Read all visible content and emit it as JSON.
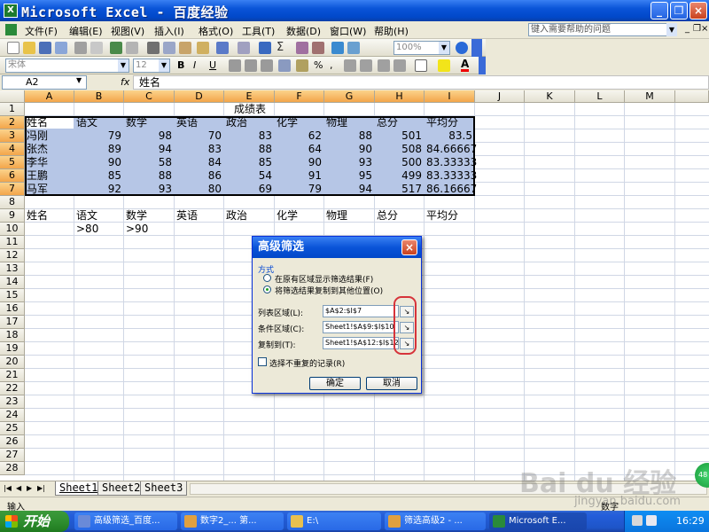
{
  "window": {
    "title": "Microsoft Excel - 百度经验",
    "app_icon": "excel-icon",
    "buttons": [
      "_",
      "❐",
      "×"
    ]
  },
  "menu": {
    "items": [
      "文件(F)",
      "编辑(E)",
      "视图(V)",
      "插入(I)",
      "格式(O)",
      "工具(T)",
      "数据(D)",
      "窗口(W)",
      "帮助(H)"
    ],
    "help_placeholder": "键入需要帮助的问题",
    "doc_buttons": [
      "_",
      "❐",
      "×"
    ]
  },
  "toolbar": {
    "zoom": "100%",
    "font_name": "宋体",
    "font_size": "12",
    "bold": "B",
    "italic": "I",
    "underline": "U",
    "percent": "%",
    "comma": ",",
    "sigma": "Σ",
    "font_color_label": "A"
  },
  "formula_bar": {
    "name_box": "A2",
    "fx": "fx",
    "content": "姓名"
  },
  "grid": {
    "columns": [
      "A",
      "B",
      "C",
      "D",
      "E",
      "F",
      "G",
      "H",
      "I",
      "J",
      "K",
      "L",
      "M"
    ],
    "rows": [
      "1",
      "2",
      "3",
      "4",
      "5",
      "6",
      "7",
      "8",
      "9",
      "10",
      "11",
      "12",
      "13",
      "14",
      "15",
      "16",
      "17",
      "18",
      "19",
      "20",
      "21",
      "22",
      "23",
      "24",
      "25",
      "26",
      "27",
      "28"
    ],
    "title": "成绩表",
    "headers": [
      "姓名",
      "语文",
      "数学",
      "英语",
      "政治",
      "化学",
      "物理",
      "总分",
      "平均分"
    ],
    "data": [
      [
        "冯刚",
        "79",
        "98",
        "70",
        "83",
        "62",
        "88",
        "501",
        "83.5"
      ],
      [
        "张杰",
        "89",
        "94",
        "83",
        "88",
        "64",
        "90",
        "508",
        "84.66667"
      ],
      [
        "李华",
        "90",
        "58",
        "84",
        "85",
        "90",
        "93",
        "500",
        "83.33333"
      ],
      [
        "王鹏",
        "85",
        "88",
        "86",
        "54",
        "91",
        "95",
        "499",
        "83.33333"
      ],
      [
        "马军",
        "92",
        "93",
        "80",
        "69",
        "79",
        "94",
        "517",
        "86.16667"
      ]
    ],
    "criteria_headers": [
      "姓名",
      "语文",
      "数学",
      "英语",
      "政治",
      "化学",
      "物理",
      "总分",
      "平均分"
    ],
    "criteria": [
      "",
      ">80",
      ">90"
    ]
  },
  "dialog": {
    "title": "高级筛选",
    "group_label": "方式",
    "option1": "在原有区域显示筛选结果(F)",
    "option2": "将筛选结果复制到其他位置(O)",
    "list_range_label": "列表区域(L):",
    "list_range_value": "$A$2:$I$7",
    "criteria_range_label": "条件区域(C):",
    "criteria_range_value": "Sheet1!$A$9:$I$10",
    "copy_to_label": "复制到(T):",
    "copy_to_value": "Sheet1!$A$12:$I$12",
    "unique_label": "选择不重复的记录(R)",
    "ok": "确定",
    "cancel": "取消",
    "close": "×"
  },
  "sheets": {
    "nav": [
      "|◀",
      "◀",
      "▶",
      "▶|"
    ],
    "tabs": [
      "Sheet1",
      "Sheet2",
      "Sheet3"
    ]
  },
  "status": {
    "left": "输入",
    "right": "数字"
  },
  "taskbar": {
    "start": "开始",
    "tasks": [
      "高级筛选_百度...",
      "数字2_... 第...",
      "E:\\",
      "筛选高级2 - ...",
      "Microsoft E..."
    ],
    "clock": "16:29"
  },
  "watermark": {
    "logo": "Bai du 经验",
    "url": "jingyan.baidu.com",
    "badge": "48"
  },
  "colors": {
    "title_blue": "#0a54d8",
    "selection": "#b6c6e6",
    "selected_header": "#f3a54a",
    "annotation_red": "#d6333a"
  }
}
